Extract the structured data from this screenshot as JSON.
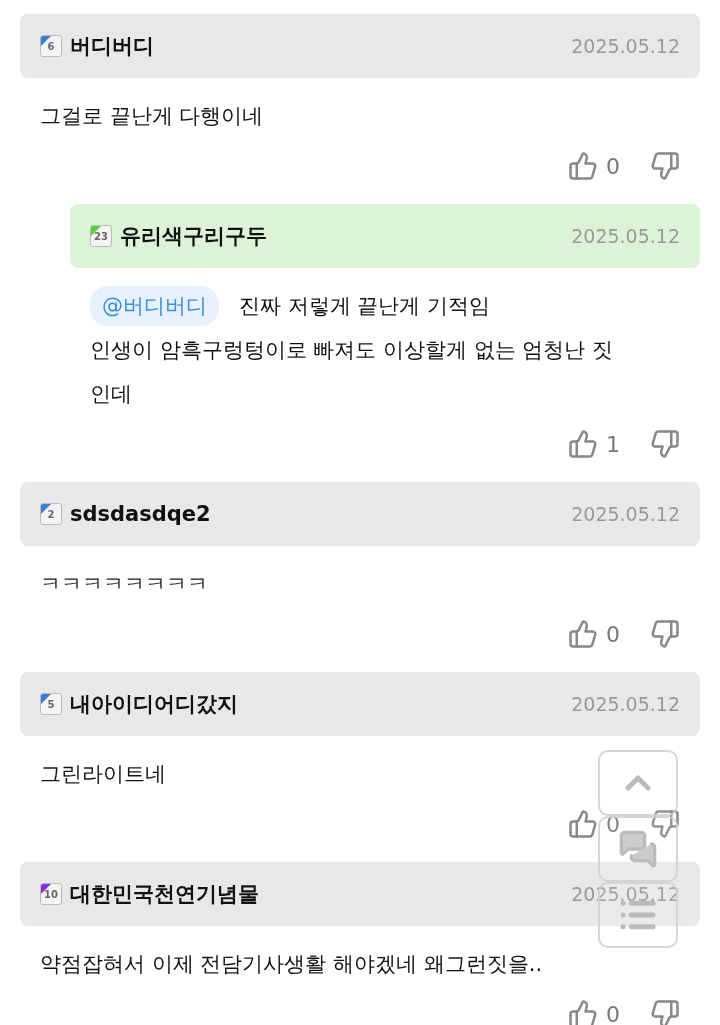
{
  "comments": [
    {
      "level": "6",
      "color": "#3a7bd5",
      "name": "버디버디",
      "date": "2025.05.12",
      "text": "그걸로 끝난게 다행이네",
      "likes": "0",
      "replies": [
        {
          "level": "23",
          "color": "#5cd03a",
          "name": "유리색구리구두",
          "date": "2025.05.12",
          "mention": "@버디버디",
          "text": "진짜 저렇게 끝난게 기적임\n인생이 암흑구렁텅이로 빠져도 이상할게 없는 엄청난 짓인데",
          "likes": "1"
        }
      ]
    },
    {
      "level": "2",
      "color": "#3a7bd5",
      "name": "sdsdasdqe2",
      "date": "2025.05.12",
      "text": "ㅋㅋㅋㅋㅋㅋㅋㅋ",
      "likes": "0"
    },
    {
      "level": "5",
      "color": "#3a7bd5",
      "name": "내아이디어디갔지",
      "date": "2025.05.12",
      "text": "그린라이트네",
      "likes": "0"
    },
    {
      "level": "10",
      "color": "#8a2be2",
      "name": "대한민국천연기념물",
      "date": "2025.05.12",
      "text": "약점잡혀서 이제 전담기사생활 해야겠네 왜그런짓을..",
      "likes": "0"
    }
  ]
}
